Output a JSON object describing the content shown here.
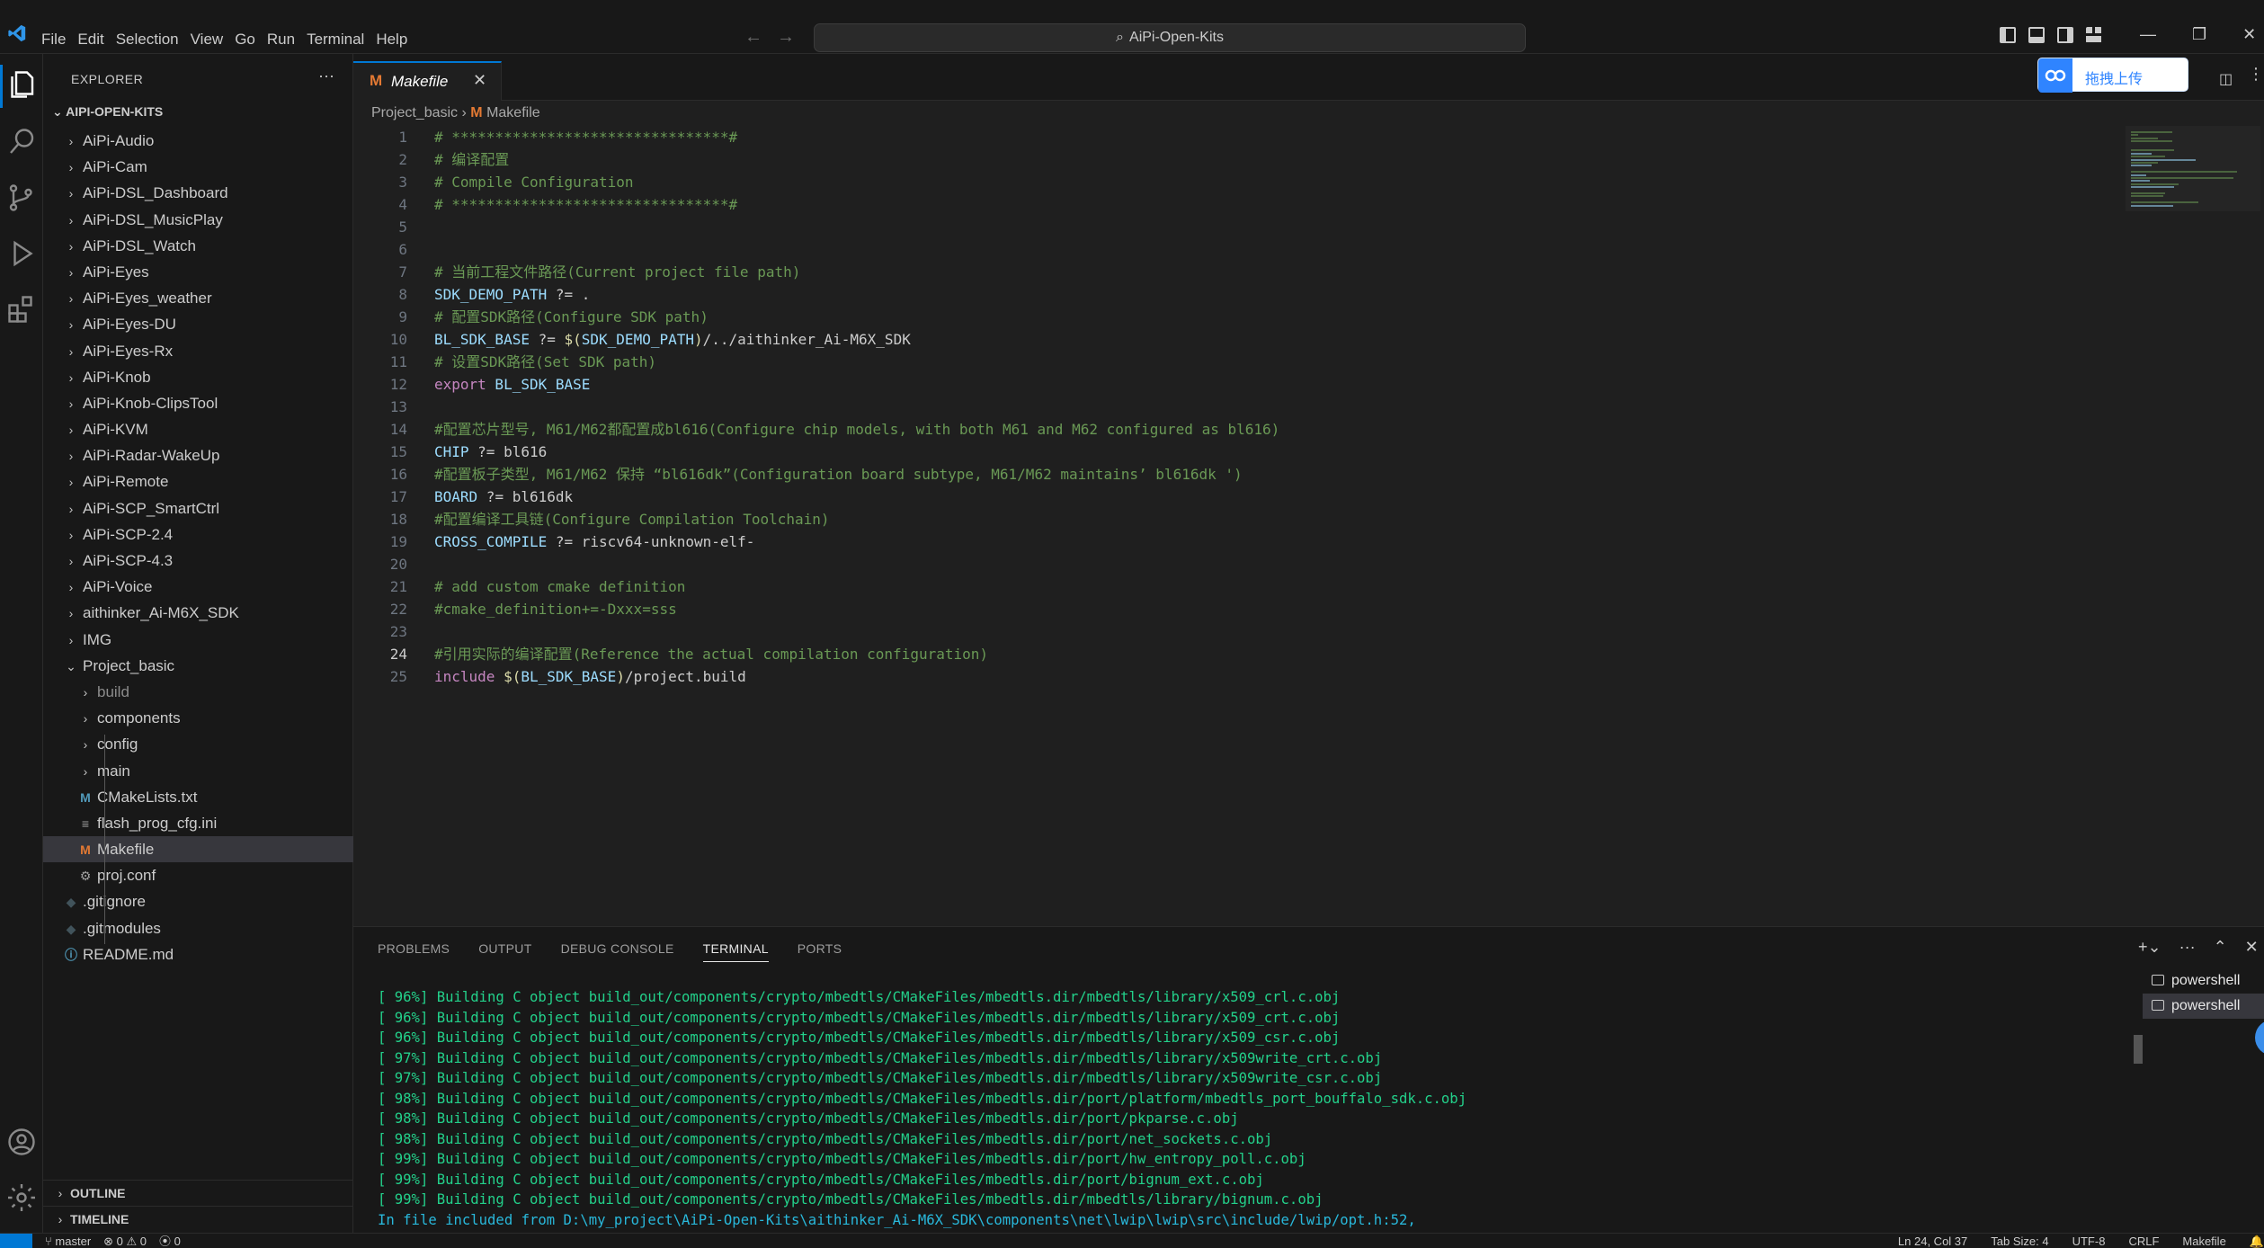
{
  "menu": [
    "File",
    "Edit",
    "Selection",
    "View",
    "Go",
    "Run",
    "Terminal",
    "Help"
  ],
  "command_center": {
    "label": "AiPi-Open-Kits",
    "icon": "search-icon"
  },
  "sidebar": {
    "title": "EXPLORER",
    "root": "AIPI-OPEN-KITS",
    "items": [
      {
        "label": "AiPi-Audio",
        "type": "folder",
        "level": 0
      },
      {
        "label": "AiPi-Cam",
        "type": "folder",
        "level": 0
      },
      {
        "label": "AiPi-DSL_Dashboard",
        "type": "folder",
        "level": 0
      },
      {
        "label": "AiPi-DSL_MusicPlay",
        "type": "folder",
        "level": 0
      },
      {
        "label": "AiPi-DSL_Watch",
        "type": "folder",
        "level": 0
      },
      {
        "label": "AiPi-Eyes",
        "type": "folder",
        "level": 0
      },
      {
        "label": "AiPi-Eyes_weather",
        "type": "folder",
        "level": 0
      },
      {
        "label": "AiPi-Eyes-DU",
        "type": "folder",
        "level": 0
      },
      {
        "label": "AiPi-Eyes-Rx",
        "type": "folder",
        "level": 0
      },
      {
        "label": "AiPi-Knob",
        "type": "folder",
        "level": 0
      },
      {
        "label": "AiPi-Knob-ClipsTool",
        "type": "folder",
        "level": 0
      },
      {
        "label": "AiPi-KVM",
        "type": "folder",
        "level": 0
      },
      {
        "label": "AiPi-Radar-WakeUp",
        "type": "folder",
        "level": 0
      },
      {
        "label": "AiPi-Remote",
        "type": "folder",
        "level": 0
      },
      {
        "label": "AiPi-SCP_SmartCtrl",
        "type": "folder",
        "level": 0
      },
      {
        "label": "AiPi-SCP-2.4",
        "type": "folder",
        "level": 0
      },
      {
        "label": "AiPi-SCP-4.3",
        "type": "folder",
        "level": 0
      },
      {
        "label": "AiPi-Voice",
        "type": "folder",
        "level": 0
      },
      {
        "label": "aithinker_Ai-M6X_SDK",
        "type": "folder",
        "level": 0
      },
      {
        "label": "IMG",
        "type": "folder",
        "level": 0
      },
      {
        "label": "Project_basic",
        "type": "folder-open",
        "level": 0
      },
      {
        "label": "build",
        "type": "folder",
        "level": 1,
        "dim": true
      },
      {
        "label": "components",
        "type": "folder",
        "level": 1
      },
      {
        "label": "config",
        "type": "folder",
        "level": 1
      },
      {
        "label": "main",
        "type": "folder",
        "level": 1
      },
      {
        "label": "CMakeLists.txt",
        "type": "makefile",
        "level": 1
      },
      {
        "label": "flash_prog_cfg.ini",
        "type": "config",
        "level": 1
      },
      {
        "label": "Makefile",
        "type": "makefile",
        "level": 1,
        "selected": true
      },
      {
        "label": "proj.conf",
        "type": "gear",
        "level": 1
      },
      {
        "label": ".gitignore",
        "type": "git",
        "level": 0
      },
      {
        "label": ".gitmodules",
        "type": "git",
        "level": 0
      },
      {
        "label": "README.md",
        "type": "info",
        "level": 0
      }
    ],
    "outline": "OUTLINE",
    "timeline": "TIMELINE"
  },
  "tab": {
    "label": "Makefile",
    "icon": "M"
  },
  "breadcrumb": {
    "folder": "Project_basic",
    "file": "Makefile",
    "icon": "M"
  },
  "upload_button": {
    "label": "拖拽上传"
  },
  "editor": {
    "current_line": 24,
    "lines": [
      [
        {
          "t": "# ********************************#",
          "c": "com"
        }
      ],
      [
        {
          "t": "# 编译配置",
          "c": "com"
        }
      ],
      [
        {
          "t": "# Compile Configuration",
          "c": "com"
        }
      ],
      [
        {
          "t": "# ********************************#",
          "c": "com"
        }
      ],
      [],
      [],
      [
        {
          "t": "# 当前工程文件路径(Current project file path)",
          "c": "com"
        }
      ],
      [
        {
          "t": "SDK_DEMO_PATH",
          "c": "var"
        },
        {
          "t": " ?= .",
          "c": "str"
        }
      ],
      [
        {
          "t": "# 配置SDK路径(Configure SDK path)",
          "c": "com"
        }
      ],
      [
        {
          "t": "BL_SDK_BASE",
          "c": "var"
        },
        {
          "t": " ?= ",
          "c": "str"
        },
        {
          "t": "$(",
          "c": "dol"
        },
        {
          "t": "SDK_DEMO_PATH",
          "c": "var"
        },
        {
          "t": ")",
          "c": "dol"
        },
        {
          "t": "/../aithinker_Ai-M6X_SDK",
          "c": "str"
        }
      ],
      [
        {
          "t": "# 设置SDK路径(Set SDK path)",
          "c": "com"
        }
      ],
      [
        {
          "t": "export",
          "c": "key"
        },
        {
          "t": " BL_SDK_BASE",
          "c": "var"
        }
      ],
      [],
      [
        {
          "t": "#配置芯片型号, M61/M62都配置成bl616(Configure chip models, with both M61 and M62 configured as bl616)",
          "c": "com"
        }
      ],
      [
        {
          "t": "CHIP",
          "c": "var"
        },
        {
          "t": " ?= bl616",
          "c": "str"
        }
      ],
      [
        {
          "t": "#配置板子类型, M61/M62 保持 “bl616dk”(Configuration board subtype, M61/M62 maintains’ bl616dk ')",
          "c": "com"
        }
      ],
      [
        {
          "t": "BOARD",
          "c": "var"
        },
        {
          "t": " ?= bl616dk",
          "c": "str"
        }
      ],
      [
        {
          "t": "#配置编译工具链(Configure Compilation Toolchain)",
          "c": "com"
        }
      ],
      [
        {
          "t": "CROSS_COMPILE",
          "c": "var"
        },
        {
          "t": " ?= riscv64-unknown-elf-",
          "c": "str"
        }
      ],
      [],
      [
        {
          "t": "# add custom cmake definition",
          "c": "com"
        }
      ],
      [
        {
          "t": "#cmake_definition+=-Dxxx=sss",
          "c": "com"
        }
      ],
      [],
      [
        {
          "t": "#引用实际的编译配置(Reference the actual compilation configuration)",
          "c": "com"
        }
      ],
      [
        {
          "t": "include",
          "c": "key"
        },
        {
          "t": " ",
          "c": "str"
        },
        {
          "t": "$(",
          "c": "dol"
        },
        {
          "t": "BL_SDK_BASE",
          "c": "var"
        },
        {
          "t": ")",
          "c": "dol"
        },
        {
          "t": "/project.build",
          "c": "str"
        }
      ]
    ]
  },
  "panel": {
    "tabs": [
      "PROBLEMS",
      "OUTPUT",
      "DEBUG CONSOLE",
      "TERMINAL",
      "PORTS"
    ],
    "active_tab": "TERMINAL",
    "terminal_lines": [
      "[ 96%] Building C object build_out/components/crypto/mbedtls/CMakeFiles/mbedtls.dir/mbedtls/library/x509_crl.c.obj",
      "[ 96%] Building C object build_out/components/crypto/mbedtls/CMakeFiles/mbedtls.dir/mbedtls/library/x509_crt.c.obj",
      "[ 96%] Building C object build_out/components/crypto/mbedtls/CMakeFiles/mbedtls.dir/mbedtls/library/x509_csr.c.obj",
      "[ 97%] Building C object build_out/components/crypto/mbedtls/CMakeFiles/mbedtls.dir/mbedtls/library/x509write_crt.c.obj",
      "[ 97%] Building C object build_out/components/crypto/mbedtls/CMakeFiles/mbedtls.dir/mbedtls/library/x509write_csr.c.obj",
      "[ 98%] Building C object build_out/components/crypto/mbedtls/CMakeFiles/mbedtls.dir/port/platform/mbedtls_port_bouffalo_sdk.c.obj",
      "[ 98%] Building C object build_out/components/crypto/mbedtls/CMakeFiles/mbedtls.dir/port/pkparse.c.obj",
      "[ 98%] Building C object build_out/components/crypto/mbedtls/CMakeFiles/mbedtls.dir/port/net_sockets.c.obj",
      "[ 99%] Building C object build_out/components/crypto/mbedtls/CMakeFiles/mbedtls.dir/port/hw_entropy_poll.c.obj",
      "[ 99%] Building C object build_out/components/crypto/mbedtls/CMakeFiles/mbedtls.dir/port/bignum_ext.c.obj",
      "[ 99%] Building C object build_out/components/crypto/mbedtls/CMakeFiles/mbedtls.dir/mbedtls/library/bignum.c.obj"
    ],
    "include_line": "In file included from D:\\my_project\\AiPi-Open-Kits\\aithinker_Ai-M6X_SDK\\components\\net\\lwip\\lwip\\src\\include/lwip/opt.h:52,",
    "terminals": [
      "powershell",
      "powershell"
    ]
  },
  "statusbar": {
    "branch": "master",
    "errors": "0",
    "warnings": "0",
    "ports": "0",
    "position": "Ln 24, Col 37",
    "tab_size": "Tab Size: 4",
    "encoding": "UTF-8",
    "eol": "CRLF",
    "language": "Makefile"
  },
  "colors": {
    "accent": "#0078d4",
    "makefile_icon": "#e37933",
    "terminal_green": "#23d18b",
    "comment": "#6a9955"
  }
}
